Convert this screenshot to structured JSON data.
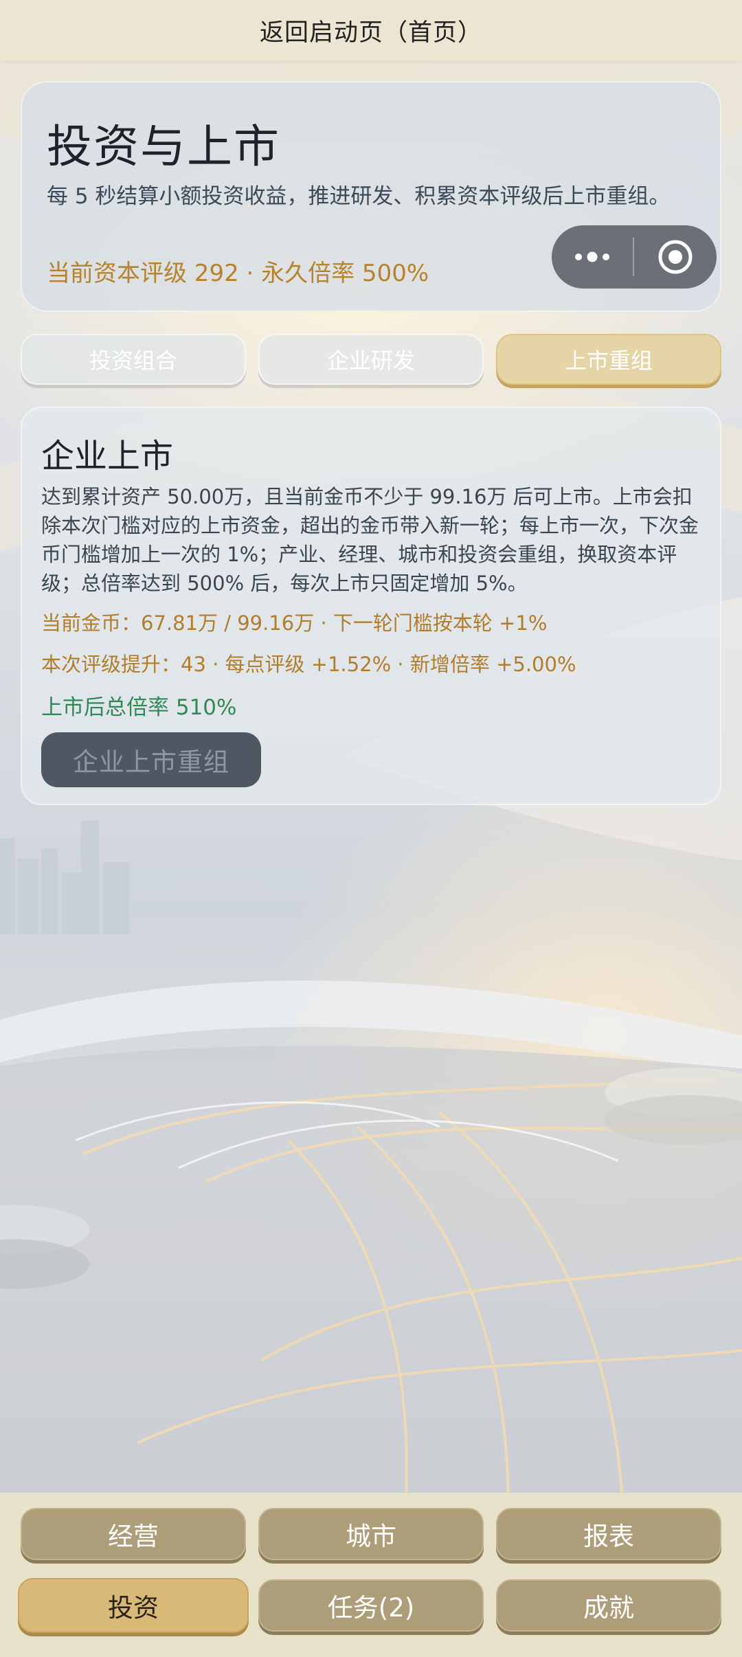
{
  "top_bar": {
    "title": "返回启动页（首页）"
  },
  "header": {
    "title": "投资与上市",
    "description": "每 5 秒结算小额投资收益，推进研发、积累资本评级后上市重组。",
    "rating_line": "当前资本评级 292 · 永久倍率 500%"
  },
  "capsule": {
    "more_icon": "more-dots-icon",
    "close_icon": "target-circle-icon"
  },
  "sub_tabs": [
    {
      "label": "投资组合",
      "active": false
    },
    {
      "label": "企业研发",
      "active": false
    },
    {
      "label": "上市重组",
      "active": true
    }
  ],
  "listing": {
    "title": "企业上市",
    "description": "达到累计资产 50.00万，且当前金币不少于 99.16万 后可上市。上市会扣除本次门槛对应的上市资金，超出的金币带入新一轮；每上市一次，下次金币门槛增加上一次的 1%；产业、经理、城市和投资会重组，换取资本评级；总倍率达到 500% 后，每次上市只固定增加 5%。",
    "coins_line": "当前金币：67.81万 / 99.16万 · 下一轮门槛按本轮 +1%",
    "rating_gain_line": "本次评级提升：43 · 每点评级 +1.52% · 新增倍率 +5.00%",
    "multiplier_after": "上市后总倍率 510%",
    "button_label": "企业上市重组"
  },
  "bottom_nav": {
    "row1": [
      {
        "label": "经营",
        "active": false
      },
      {
        "label": "城市",
        "active": false
      },
      {
        "label": "报表",
        "active": false
      }
    ],
    "row2": [
      {
        "label": "投资",
        "active": true
      },
      {
        "label": "任务(2)",
        "active": false
      },
      {
        "label": "成就",
        "active": false
      }
    ]
  },
  "colors": {
    "accent_gold": "#b8822a",
    "active_tab": "#e5d4a5",
    "nav_button": "#ad9e79",
    "nav_active": "#d9b978",
    "success_green": "#2e8a55",
    "disabled_button": "#4d5862"
  }
}
